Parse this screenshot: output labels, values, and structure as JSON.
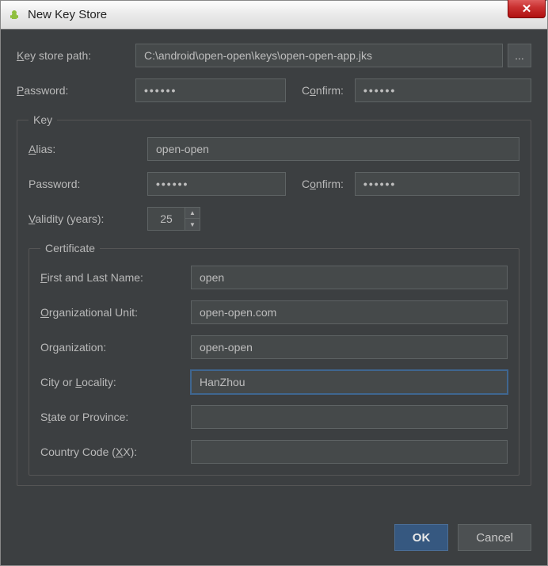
{
  "window": {
    "title": "New Key Store",
    "close_glyph": "✕"
  },
  "keystore": {
    "path_label_pre": "K",
    "path_label_post": "ey store path:",
    "path_value": "C:\\android\\open-open\\keys\\open-open-app.jks",
    "browse_glyph": "...",
    "password_label_pre": "P",
    "password_label_post": "assword:",
    "password_dots": "••••••",
    "confirm_label_pre": "C",
    "confirm_label_mid": "o",
    "confirm_label_post": "nfirm:",
    "confirm_dots": "••••••"
  },
  "key": {
    "legend": "Key",
    "alias_label_pre": "A",
    "alias_label_post": "lias:",
    "alias_value": "open-open",
    "password_label_pre": "P",
    "password_label_post": "assword:",
    "password_dots": "••••••",
    "confirm_label_pre": "C",
    "confirm_label_mid": "o",
    "confirm_label_post": "nfirm:",
    "confirm_dots": "••••••",
    "validity_label_pre": "V",
    "validity_label_post": "alidity (years):",
    "validity_value": "25"
  },
  "cert": {
    "legend": "Certificate",
    "first_pre": "F",
    "first_post": "irst and Last Name:",
    "first_value": "open",
    "ou_pre": "O",
    "ou_post": "rganizational Unit:",
    "ou_value": "open-open.com",
    "org_label": "Organization:",
    "org_value": "open-open",
    "city_pre": "City or ",
    "city_u": "L",
    "city_post": "ocality:",
    "city_value": "HanZhou",
    "state_pre": "S",
    "state_u": "t",
    "state_post": "ate or Province:",
    "state_value": "",
    "cc_pre": "Country Code (",
    "cc_u": "X",
    "cc_post": "X):",
    "cc_value": ""
  },
  "buttons": {
    "ok": "OK",
    "cancel": "Cancel"
  }
}
